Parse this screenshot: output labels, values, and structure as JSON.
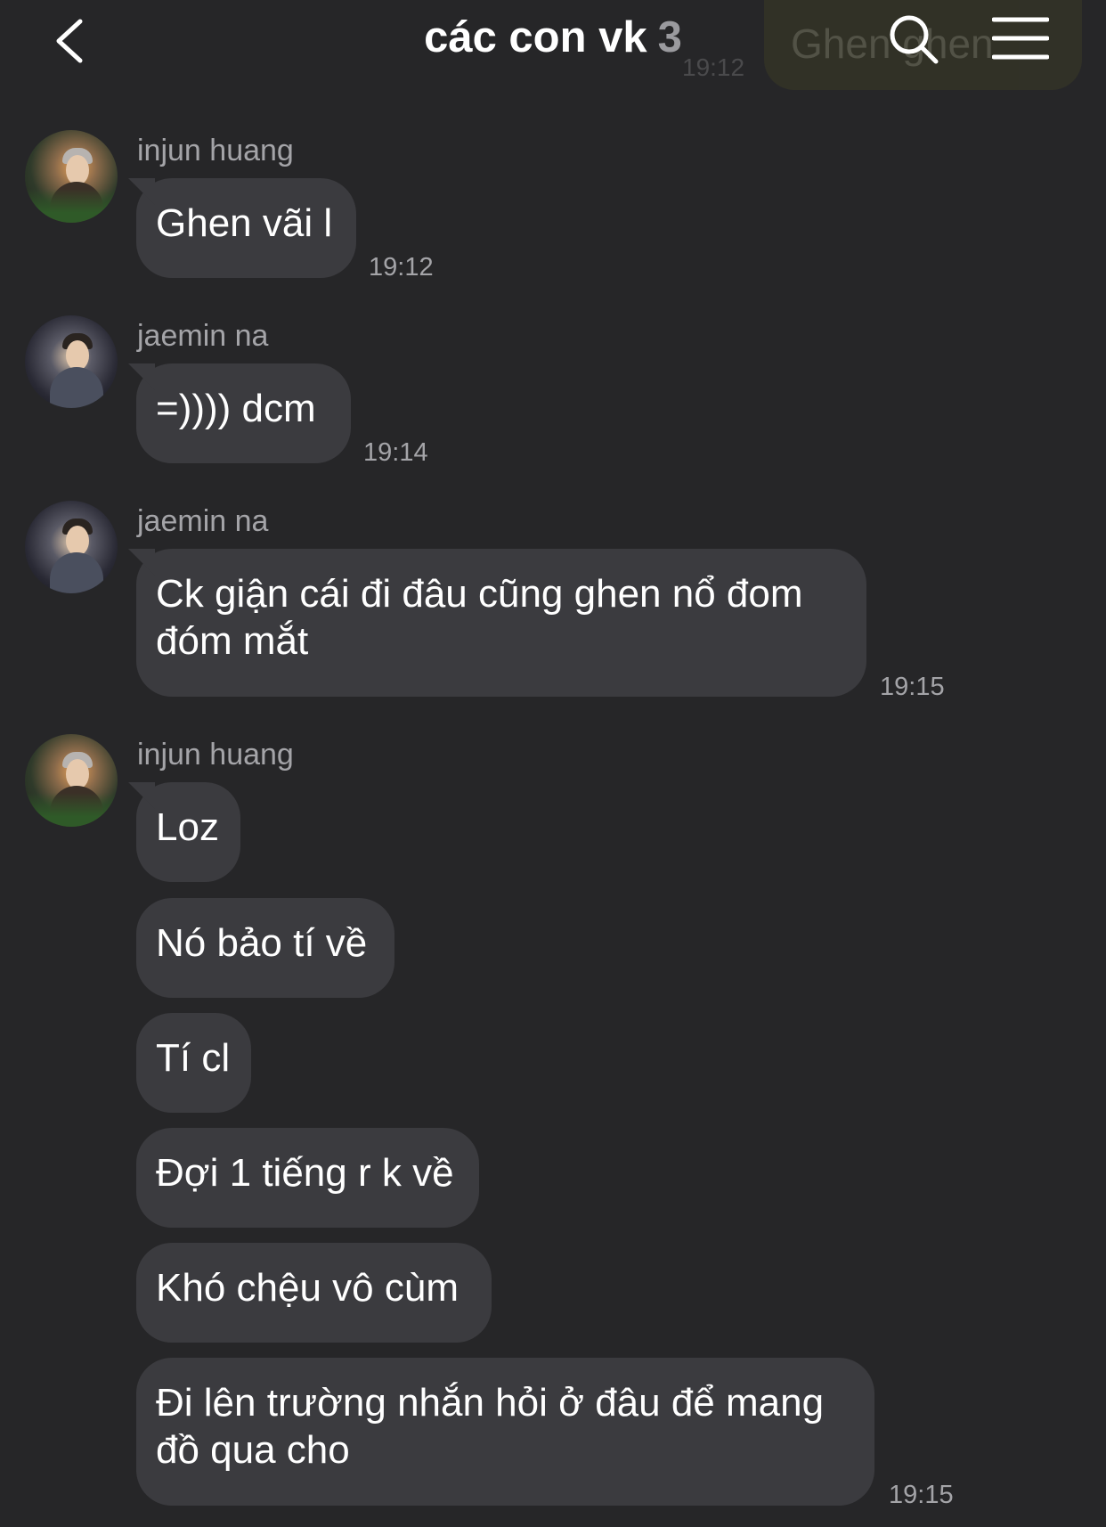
{
  "header": {
    "title": "các con vk",
    "member_count": "3",
    "back_icon": "chevron-left-icon",
    "search_icon": "search-icon",
    "menu_icon": "menu-icon"
  },
  "background_ghost": {
    "text": "Ghen ghen",
    "time": "19:12"
  },
  "messages": [
    {
      "sender": "injun huang",
      "text": "Ghen vãi l",
      "time": "19:12"
    },
    {
      "sender": "jaemin na",
      "text": "=)))) dcm",
      "time": "19:14"
    },
    {
      "sender": "jaemin na",
      "text": "Ck giận cái đi đâu cũng ghen nổ đom đóm mắt",
      "time": "19:15"
    },
    {
      "sender": "injun huang",
      "text": "Loz"
    },
    {
      "text": "Nó bảo tí về"
    },
    {
      "text": "Tí cl"
    },
    {
      "text": "Đợi 1 tiếng r k về"
    },
    {
      "text": "Khó chệu vô cùm"
    },
    {
      "text": "Đi lên trường nhắn hỏi ở đâu để mang đồ qua cho",
      "time": "19:15"
    }
  ],
  "colors": {
    "background": "#262628",
    "bubble": "#3b3b3f",
    "secondary_text": "#a4a4a8"
  }
}
